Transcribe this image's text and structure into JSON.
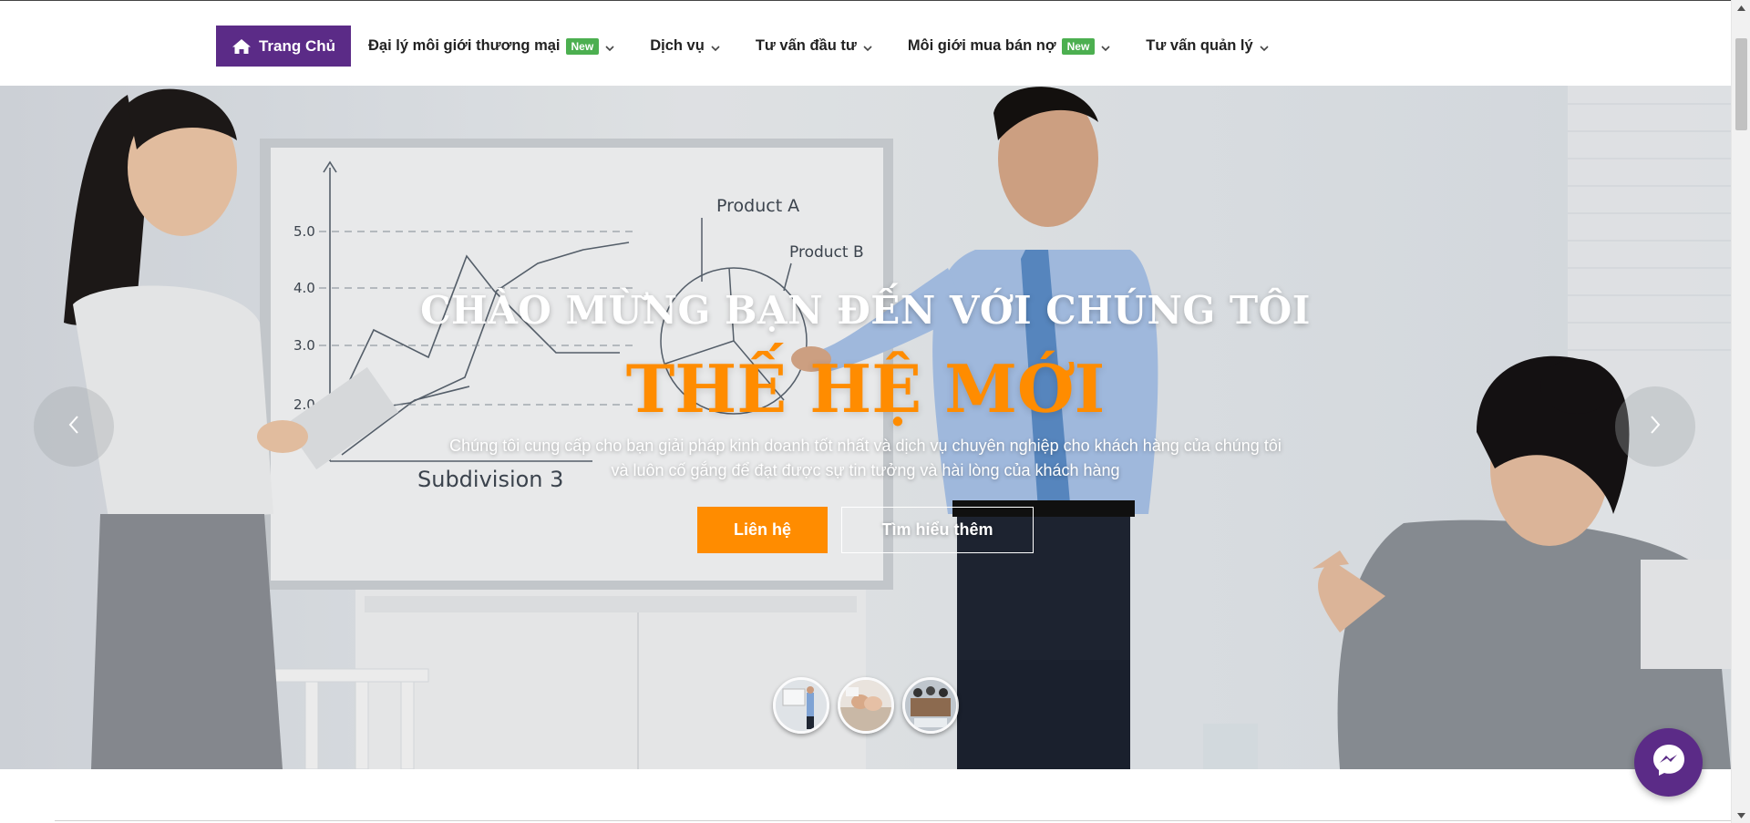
{
  "nav": {
    "home_label": "Trang Chủ",
    "items": [
      {
        "label": "Đại lý môi giới thương mại",
        "badge": "New"
      },
      {
        "label": "Dịch vụ"
      },
      {
        "label": "Tư vấn đầu tư"
      },
      {
        "label": "Môi giới mua bán nợ",
        "badge": "New"
      },
      {
        "label": "Tư vấn quản lý"
      }
    ]
  },
  "hero": {
    "subtitle": "CHÀO MỪNG BẠN ĐẾN VỚI CHÚNG TÔI",
    "title": "THẾ HỆ MỚI",
    "description_line1": "Chúng tôi cung cấp cho bạn giải pháp kinh doanh tốt nhất và dịch vụ chuyên nghiệp cho khách hàng của chúng tôi",
    "description_line2": "và luôn cố gắng để đạt được sự tin tưởng và hài lòng của khách hàng",
    "btn_contact": "Liên hệ",
    "btn_more": "Tìm hiểu thêm",
    "whiteboard_labels": {
      "product_a": "Product A",
      "product_b": "Product B",
      "subdivision": "Subdivision 3",
      "y_ticks": [
        "5.0",
        "4.0",
        "3.0",
        "2.0"
      ]
    },
    "slide_count": 3
  },
  "colors": {
    "brand_purple": "#5b2b87",
    "accent_orange": "#ff8c00",
    "badge_green": "#4caf50"
  },
  "icons": {
    "home": "home-icon",
    "chevron": "chevron-down-icon",
    "prev": "chevron-left-icon",
    "next": "chevron-right-icon",
    "messenger": "messenger-icon"
  }
}
